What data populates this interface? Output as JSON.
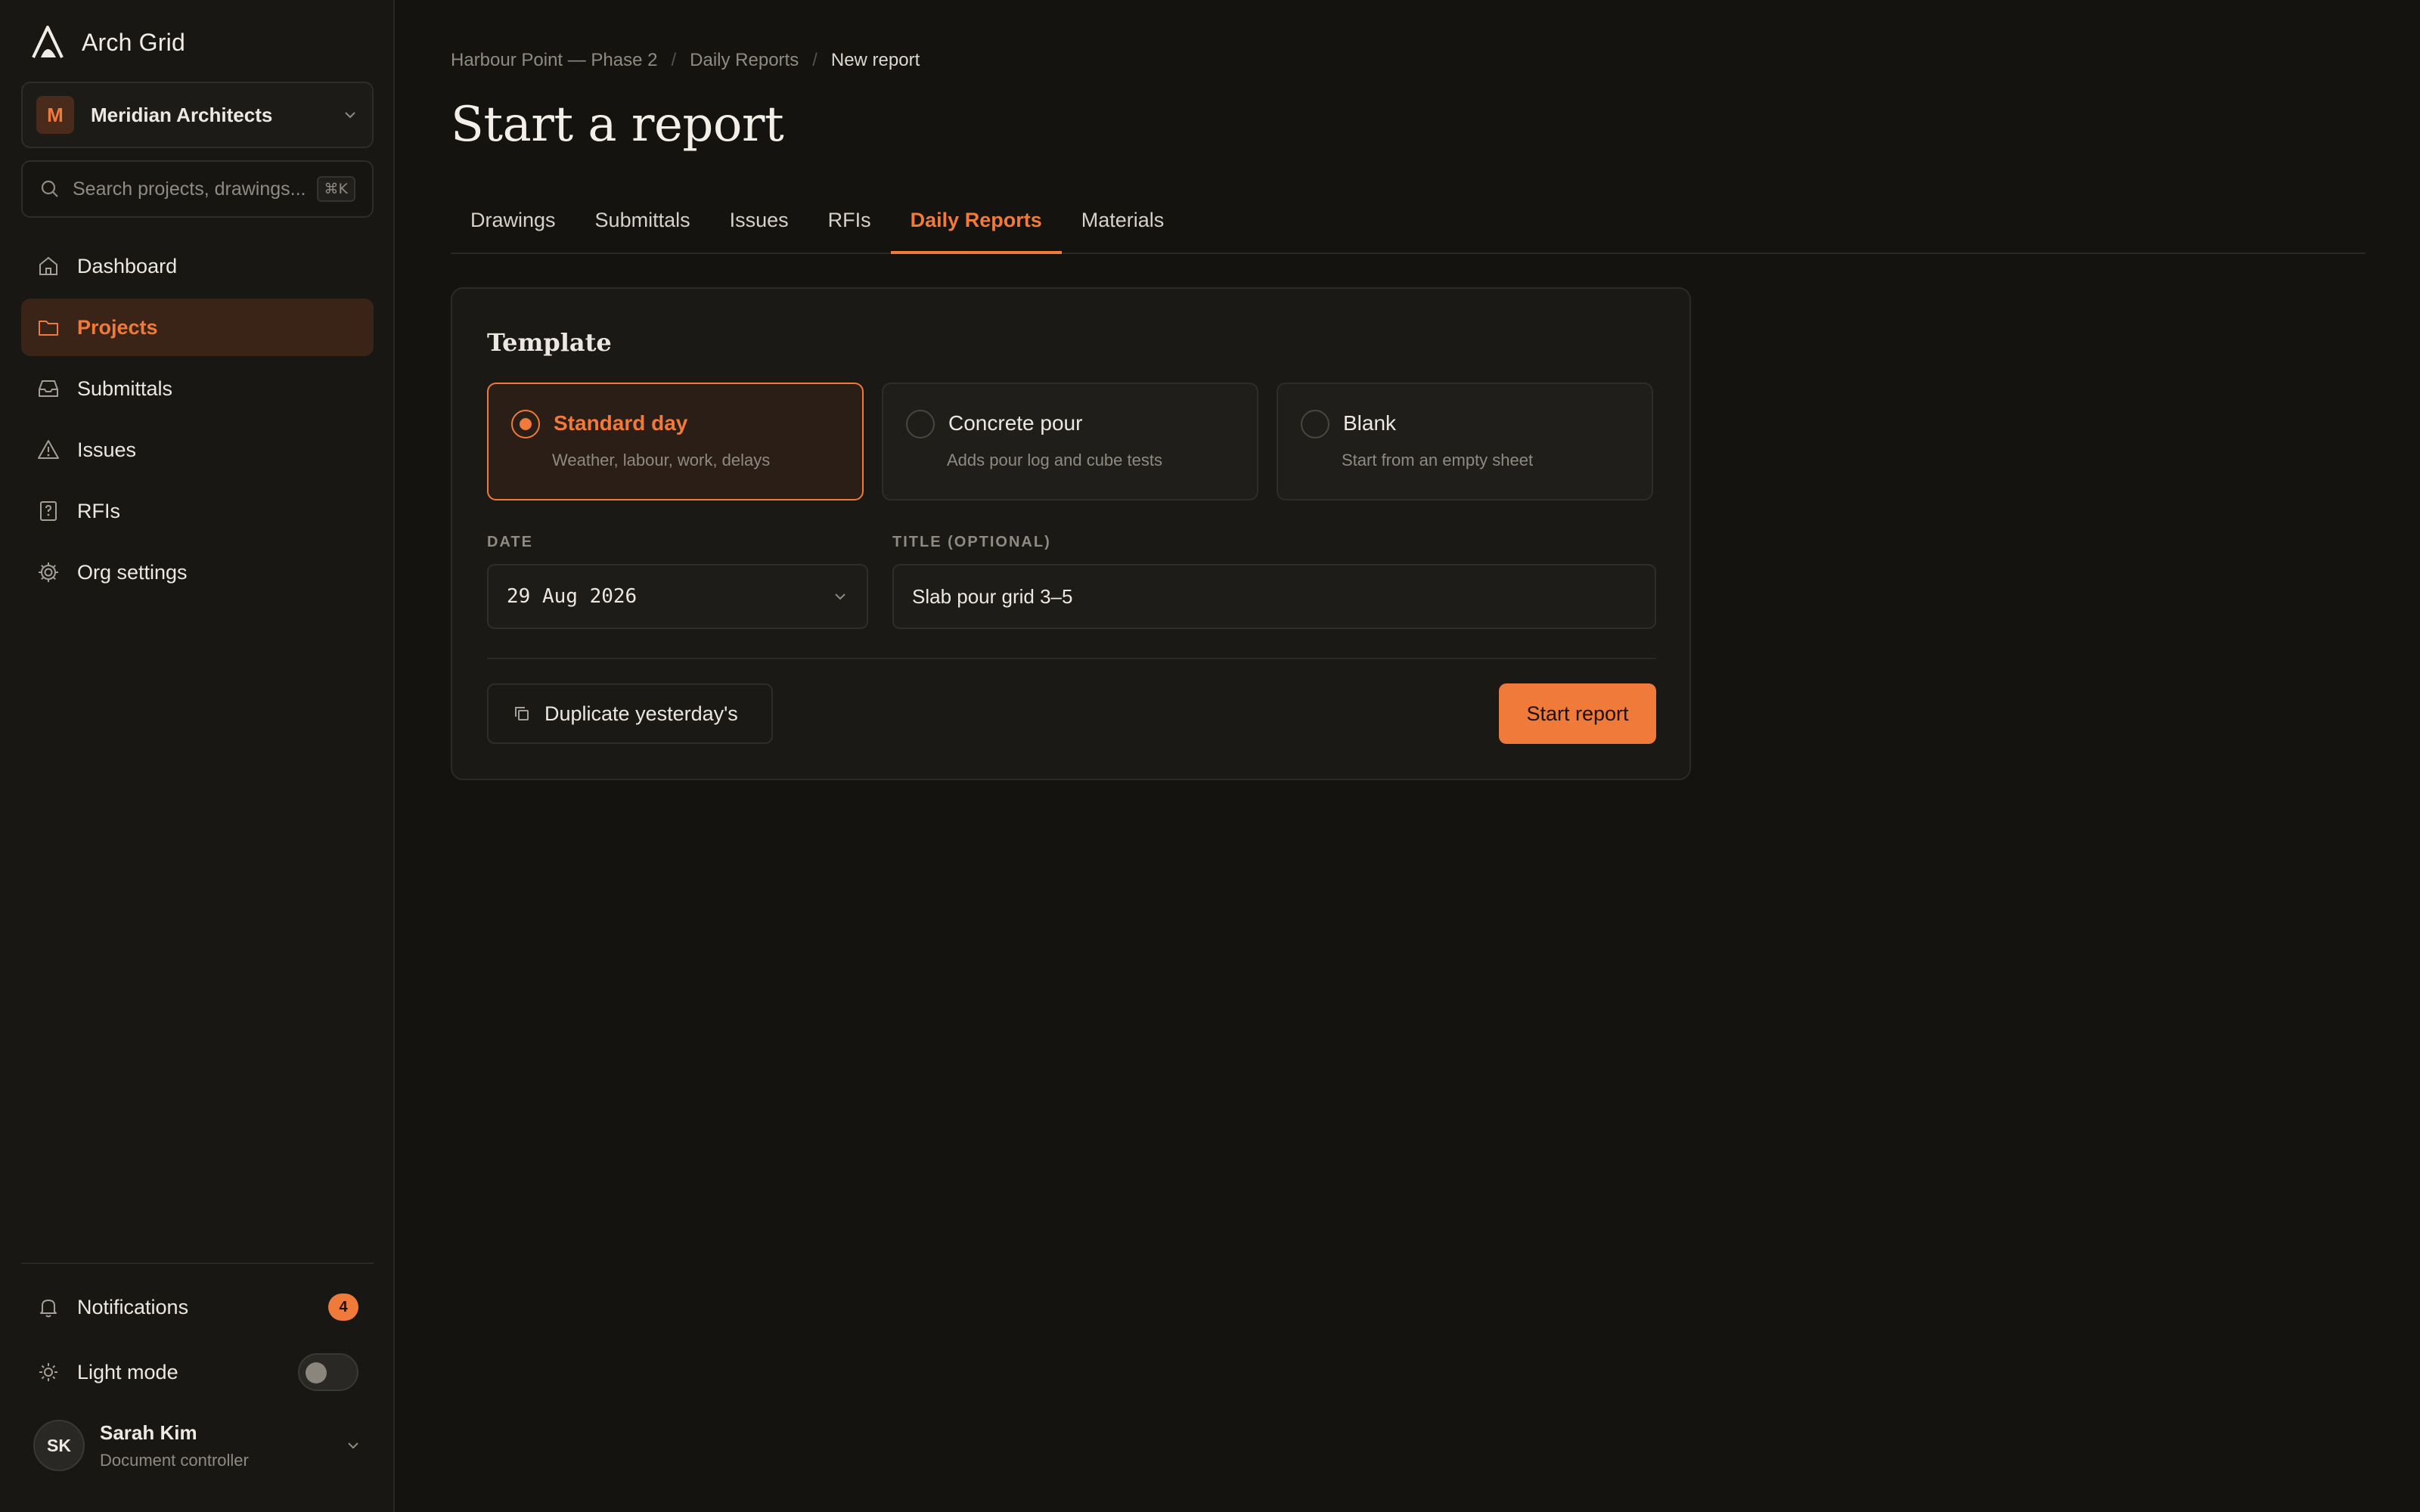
{
  "app": {
    "name": "Arch Grid",
    "logo_icon": "arch-logo-icon"
  },
  "org": {
    "initial": "M",
    "name": "Meridian Architects"
  },
  "search": {
    "placeholder": "Search projects, drawings...",
    "shortcut": "⌘K"
  },
  "sidebar": {
    "items": [
      {
        "label": "Dashboard",
        "icon": "home-icon",
        "active": false
      },
      {
        "label": "Projects",
        "icon": "folder-icon",
        "active": true
      },
      {
        "label": "Submittals",
        "icon": "inbox-icon",
        "active": false
      },
      {
        "label": "Issues",
        "icon": "warning-icon",
        "active": false
      },
      {
        "label": "RFIs",
        "icon": "question-icon",
        "active": false
      },
      {
        "label": "Org settings",
        "icon": "gear-icon",
        "active": false
      }
    ],
    "notifications": {
      "label": "Notifications",
      "count": "4"
    },
    "light_mode": {
      "label": "Light mode",
      "enabled": false
    }
  },
  "user": {
    "initials": "SK",
    "name": "Sarah Kim",
    "role": "Document controller"
  },
  "breadcrumb": [
    "Harbour Point — Phase 2",
    "Daily Reports",
    "New report"
  ],
  "page": {
    "title": "Start a report"
  },
  "tabs": [
    {
      "label": "Drawings",
      "active": false
    },
    {
      "label": "Submittals",
      "active": false
    },
    {
      "label": "Issues",
      "active": false
    },
    {
      "label": "RFIs",
      "active": false
    },
    {
      "label": "Daily Reports",
      "active": true
    },
    {
      "label": "Materials",
      "active": false
    }
  ],
  "form": {
    "section_title": "Template",
    "templates": [
      {
        "name": "Standard day",
        "desc": "Weather, labour, work, delays",
        "selected": true
      },
      {
        "name": "Concrete pour",
        "desc": "Adds pour log and cube tests",
        "selected": false
      },
      {
        "name": "Blank",
        "desc": "Start from an empty sheet",
        "selected": false
      }
    ],
    "date_label": "DATE",
    "date_value": "29 Aug 2026",
    "title_label": "TITLE (OPTIONAL)",
    "title_value": "Slab pour grid 3–5",
    "duplicate_label": "Duplicate yesterday's",
    "start_label": "Start report"
  },
  "colors": {
    "accent": "#ef7a3a",
    "background": "#141310",
    "sidebar": "#181714"
  }
}
